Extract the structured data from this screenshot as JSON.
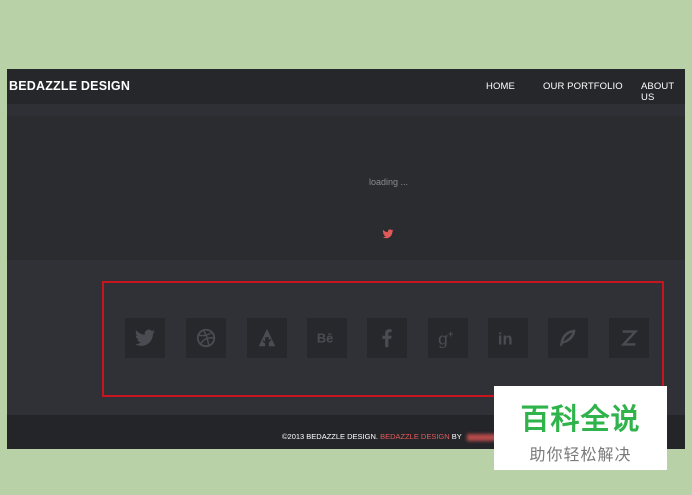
{
  "header": {
    "brand": "BEDAZZLE DESIGN",
    "nav": [
      {
        "label": "HOME"
      },
      {
        "label": "OUR PORTFOLIO"
      },
      {
        "label": "ABOUT US"
      }
    ]
  },
  "hero": {
    "loading_text": "loading ..."
  },
  "social": {
    "icons": [
      "twitter-icon",
      "dribbble-icon",
      "forrst-icon",
      "behance-icon",
      "facebook-icon",
      "google-plus-icon",
      "linkedin-icon",
      "vine-icon",
      "zerply-icon"
    ]
  },
  "footer": {
    "copyright": "©2013 BEDAZZLE DESIGN.",
    "brand_link": "BEDAZZLE DESIGN",
    "by": "BY"
  },
  "watermark": {
    "main": "百科全说",
    "sub": "助你轻松解决"
  },
  "colors": {
    "accent_red": "#c8141e",
    "brand_link": "#e35a5a",
    "watermark_green": "#2fb34a"
  }
}
